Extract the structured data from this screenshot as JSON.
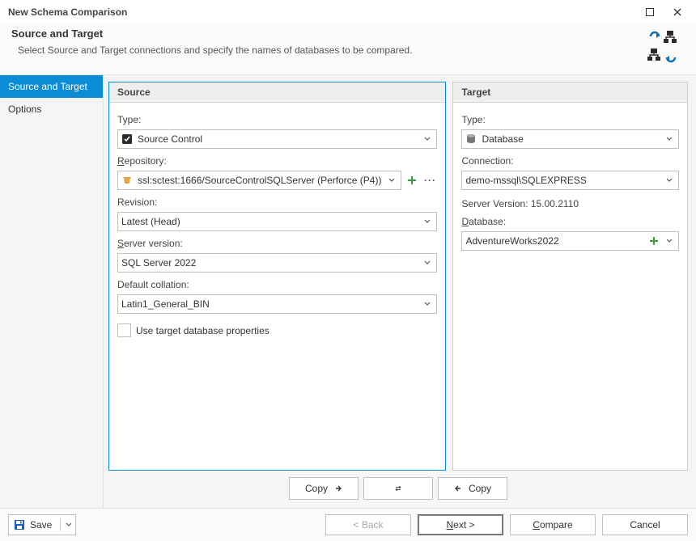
{
  "window": {
    "title": "New Schema Comparison"
  },
  "header": {
    "subtitle": "Source and Target",
    "description": "Select Source and Target connections and specify the names of databases to be compared."
  },
  "nav": {
    "items": [
      {
        "label": "Source and Target",
        "active": true
      },
      {
        "label": "Options",
        "active": false
      }
    ]
  },
  "source": {
    "title": "Source",
    "type_label": "Type:",
    "type_value": "Source Control",
    "type_icon": "source-control-icon",
    "repo_label_pre": "R",
    "repo_label_rest": "epository:",
    "repo_value": "ssl:sctest:1666/SourceControlSQLServer (Perforce (P4))",
    "repo_icon": "repository-icon",
    "rev_label": "Revision:",
    "rev_value": "Latest (Head)",
    "serverver_label_pre": "S",
    "serverver_label_rest": "erver version:",
    "serverver_value": "SQL Server 2022",
    "collation_label": "Default collation:",
    "collation_value": "Latin1_General_BIN",
    "usetarget_label_pre": "U",
    "usetarget_label_rest": "se target database properties"
  },
  "target": {
    "title": "Target",
    "type_label": "Type:",
    "type_value": "Database",
    "type_icon": "database-icon",
    "conn_label": "Connection:",
    "conn_value": "demo-mssql\\SQLEXPRESS",
    "serverver_static": "Server Version: 15.00.2110",
    "db_label_pre": "D",
    "db_label_rest": "atabase:",
    "db_value": "AdventureWorks2022"
  },
  "copyrow": {
    "copy_right": "Copy",
    "copy_left": "Copy"
  },
  "footer": {
    "save": "Save",
    "back": "< Back",
    "next_pre": "N",
    "next_rest": "ext >",
    "compare_pre": "C",
    "compare_rest": "ompare",
    "cancel": "Cancel"
  }
}
